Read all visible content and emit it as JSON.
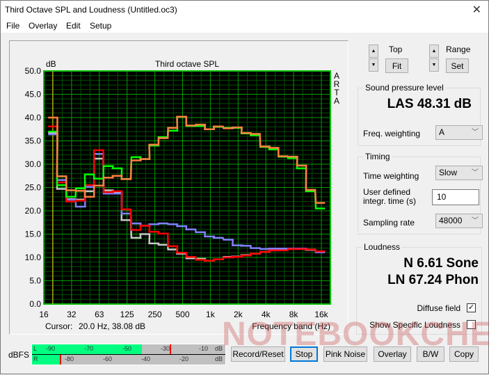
{
  "window": {
    "title": "Third Octave SPL and Loudness (Untitled.oc3)",
    "close_glyph": "✕"
  },
  "menu": [
    {
      "label": "File"
    },
    {
      "label": "Overlay"
    },
    {
      "label": "Edit"
    },
    {
      "label": "Setup"
    }
  ],
  "chart": {
    "ylabel_unit": "dB",
    "title": "Third octave SPL",
    "brand": [
      "A",
      "R",
      "T",
      "A"
    ],
    "cursor_label": "Cursor:",
    "cursor_value": "20.0 Hz, 38.08 dB",
    "xlabel": "Frequency band (Hz)"
  },
  "chart_data": {
    "type": "line",
    "step": true,
    "title": "Third octave SPL",
    "ylabel": "dB",
    "xlabel": "Frequency band (Hz)",
    "ylim": [
      0,
      50
    ],
    "yticks": [
      "0.0",
      "5.0",
      "10.0",
      "15.0",
      "20.0",
      "25.0",
      "30.0",
      "35.0",
      "40.0",
      "45.0",
      "50.0"
    ],
    "xticks": [
      "16",
      "32",
      "63",
      "125",
      "250",
      "500",
      "1k",
      "2k",
      "4k",
      "8k",
      "16k"
    ],
    "xscale": "log",
    "grid": true,
    "cursor_hz": 20,
    "bands_hz": [
      20,
      25,
      31.5,
      40,
      50,
      63,
      80,
      100,
      125,
      160,
      200,
      250,
      315,
      400,
      500,
      630,
      800,
      1000,
      1250,
      1600,
      2000,
      2500,
      3150,
      4000,
      5000,
      6300,
      8000,
      10000,
      12500,
      16000
    ],
    "series": [
      {
        "color": "#c8c8c8",
        "values": [
          36.7,
          24.7,
          22.5,
          22.4,
          24.2,
          31.2,
          24.4,
          24.0,
          18.0,
          14.2,
          15.0,
          13.0,
          12.7,
          11.7,
          10.8,
          9.8,
          9.7,
          9.3,
          9.6,
          10.1,
          10.2,
          10.5,
          10.8,
          11.2,
          11.5,
          11.7,
          11.8,
          11.8,
          11.6,
          11.2
        ]
      },
      {
        "color": "#8080ff",
        "values": [
          36.4,
          26.6,
          22.4,
          20.9,
          25.1,
          32.2,
          23.7,
          23.7,
          19.4,
          17.3,
          16.8,
          17.1,
          17.3,
          17.1,
          16.7,
          16.0,
          15.4,
          14.5,
          14.2,
          13.8,
          12.6,
          12.5,
          12.0,
          11.8,
          11.9,
          11.9,
          11.9,
          11.9,
          11.7,
          11.1
        ]
      },
      {
        "color": "#ff0000",
        "values": [
          38.1,
          26.1,
          22.0,
          22.2,
          25.5,
          33.0,
          24.0,
          24.2,
          20.3,
          15.9,
          16.8,
          15.5,
          15.1,
          12.4,
          11.0,
          10.1,
          9.5,
          9.3,
          9.6,
          10.0,
          10.1,
          10.4,
          10.8,
          11.2,
          11.5,
          11.5,
          11.8,
          11.8,
          11.7,
          11.3
        ]
      },
      {
        "color": "#00ff00",
        "values": [
          37.0,
          25.5,
          23.0,
          24.8,
          27.8,
          26.9,
          29.6,
          29.1,
          26.8,
          31.5,
          31.1,
          34.0,
          35.8,
          37.2,
          40.1,
          38.2,
          38.2,
          37.5,
          38.0,
          37.8,
          37.8,
          36.6,
          36.2,
          33.7,
          33.2,
          31.6,
          31.3,
          29.1,
          24.2,
          20.5
        ]
      },
      {
        "color": "#ff8040",
        "values": [
          40.0,
          27.4,
          24.4,
          24.3,
          23.0,
          25.4,
          27.1,
          27.5,
          26.8,
          30.8,
          31.1,
          34.2,
          35.6,
          37.8,
          40.2,
          38.3,
          38.5,
          37.5,
          38.1,
          37.7,
          37.9,
          36.7,
          36.5,
          33.8,
          33.5,
          31.7,
          31.6,
          29.7,
          24.5,
          21.7
        ]
      }
    ]
  },
  "controls": {
    "top_label": "Top",
    "fit_label": "Fit",
    "range_label": "Range",
    "set_label": "Set",
    "up": "▲",
    "down": "▼"
  },
  "spl": {
    "group": "Sound pressure level",
    "value": "LAS 48.31 dB",
    "freq_weighting_label": "Freq. weighting",
    "freq_weighting": "A"
  },
  "timing": {
    "group": "Timing",
    "time_weighting_label": "Time weighting",
    "time_weighting": "Slow",
    "integ_label_1": "User defined",
    "integ_label_2": "integr. time (s)",
    "integ_value": "10",
    "sampling_label": "Sampling rate",
    "sampling_rate": "48000"
  },
  "loudness": {
    "group": "Loudness",
    "n": "N 6.61 Sone",
    "ln": "LN 67.24 Phon",
    "diffuse_label": "Diffuse field",
    "diffuse_checked": true,
    "specific_label": "Show Specific Loudness",
    "specific_checked": false
  },
  "meter": {
    "label": "dBFS",
    "l": "L",
    "r": "R",
    "l_ticks": [
      "-90",
      "-70",
      "-50",
      "-30",
      "-10",
      "dB"
    ],
    "r_ticks": [
      "-80",
      "-60",
      "-40",
      "-20",
      "dB"
    ],
    "l_level_dbfs": -42,
    "l_peak_dbfs": -28,
    "r_level_dbfs": -83,
    "r_peak_dbfs": -83
  },
  "buttons": {
    "record": "Record/Reset",
    "stop": "Stop",
    "pink": "Pink Noise",
    "overlay": "Overlay",
    "bw": "B/W",
    "copy": "Copy"
  },
  "watermark": "NOTEBOOKCHECK",
  "colors": {
    "plot_bg": "#000000",
    "grid_major": "#00a000",
    "grid_minor": "#005000",
    "cursor": "#c8c800",
    "focus": "#0078d7"
  }
}
